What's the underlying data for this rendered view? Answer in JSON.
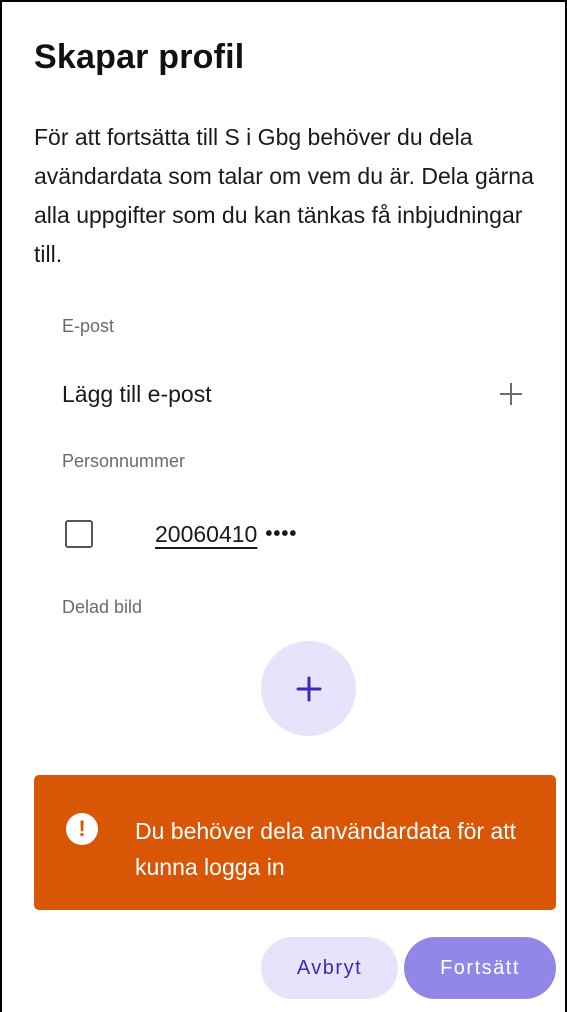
{
  "header": {
    "title": "Skapar profil"
  },
  "intro": {
    "text": "För att fortsätta till S i Gbg behöver du dela avändardata som talar om vem du är. Dela gärna alla uppgifter som du kan tänkas få inbjudningar till."
  },
  "email": {
    "label": "E-post",
    "add_text": "Lägg till e-post",
    "icon": "plus-icon"
  },
  "personnummer": {
    "label": "Personnummer",
    "number": "20060410",
    "mask": "••••",
    "checked": false
  },
  "photo": {
    "label": "Delad bild",
    "icon": "plus-icon"
  },
  "alert": {
    "icon": "exclamation-icon",
    "text": "Du behöver dela användardata för att kunna logga in",
    "color": "#d95606"
  },
  "actions": {
    "cancel_label": "Avbryt",
    "continue_label": "Fortsätt"
  },
  "colors": {
    "accent": "#3c2ab8",
    "accent_light": "#e6e3fa",
    "button_primary": "#9187e9",
    "warning": "#d95606"
  }
}
